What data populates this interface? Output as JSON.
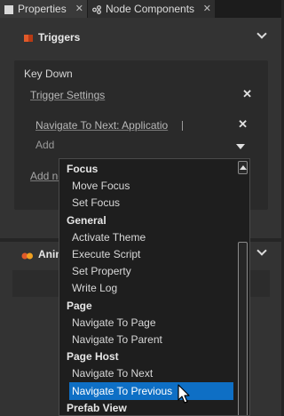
{
  "tabs": [
    {
      "label": "Properties",
      "close": "✕",
      "icon": "properties-icon"
    },
    {
      "label": "Node Components",
      "close": "✕",
      "icon": "node-components-icon"
    }
  ],
  "triggers": {
    "title": "Triggers",
    "icon": "trigger-icon",
    "trigger": {
      "name": "Key Down",
      "settings_label": "Trigger Settings",
      "remove_symbol": "✕",
      "action_label": "Navigate To Next: Applicatio",
      "add_placeholder": "Add",
      "add_new_label": "Add ne"
    }
  },
  "animations": {
    "title": "Anim",
    "icon": "animation-icon"
  },
  "dropdown": {
    "items": [
      {
        "text": "Focus",
        "kind": "category"
      },
      {
        "text": "Move Focus",
        "kind": "option"
      },
      {
        "text": "Set Focus",
        "kind": "option"
      },
      {
        "text": "General",
        "kind": "category"
      },
      {
        "text": "Activate Theme",
        "kind": "option"
      },
      {
        "text": "Execute Script",
        "kind": "option"
      },
      {
        "text": "Set Property",
        "kind": "option"
      },
      {
        "text": "Write Log",
        "kind": "option"
      },
      {
        "text": "Page",
        "kind": "category"
      },
      {
        "text": "Navigate To Page",
        "kind": "option"
      },
      {
        "text": "Navigate To Parent",
        "kind": "option"
      },
      {
        "text": "Page Host",
        "kind": "category"
      },
      {
        "text": "Navigate To Next",
        "kind": "option"
      },
      {
        "text": "Navigate To Previous",
        "kind": "option",
        "selected": true
      },
      {
        "text": "Prefab View",
        "kind": "category"
      }
    ]
  },
  "colors": {
    "selection": "#0e6fc5",
    "panel": "#333333",
    "dropdown_bg": "#1e1e1e"
  }
}
